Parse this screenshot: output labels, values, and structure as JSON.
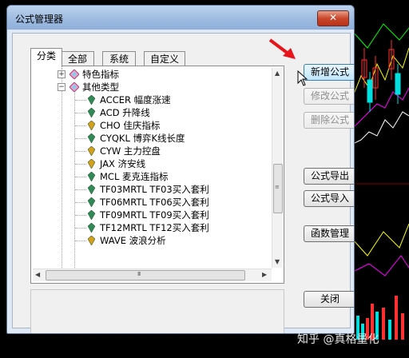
{
  "dialog": {
    "title": "公式管理器",
    "close_glyph": "✕",
    "tabs": [
      {
        "label": "分类",
        "active": true
      },
      {
        "label": "全部",
        "active": false
      },
      {
        "label": "系统",
        "active": false
      },
      {
        "label": "自定义",
        "active": false
      }
    ],
    "tree": {
      "categories": [
        {
          "label": "特色指标",
          "expanded": false
        },
        {
          "label": "其他类型",
          "expanded": true
        }
      ],
      "formulas": [
        {
          "label": "ACCER 幅度涨速",
          "color": "#2e8b57"
        },
        {
          "label": "ACD 升降线",
          "color": "#2e8b57"
        },
        {
          "label": "CHO 佳庆指标",
          "color": "#d4a017"
        },
        {
          "label": "CYQKL 博弈K线长度",
          "color": "#2e8b57"
        },
        {
          "label": "CYW 主力控盘",
          "color": "#d4a017"
        },
        {
          "label": "JAX 济安线",
          "color": "#d4a017"
        },
        {
          "label": "MCL 麦克连指标",
          "color": "#2e8b57"
        },
        {
          "label": "TF03MRTL TF03买入套利",
          "color": "#2e8b57"
        },
        {
          "label": "TF06MRTL TF06买入套利",
          "color": "#2e8b57"
        },
        {
          "label": "TF09MRTL TF09买入套利",
          "color": "#2e8b57"
        },
        {
          "label": "TF12MRTL TF12买入套利",
          "color": "#2e8b57"
        },
        {
          "label": "WAVE 波浪分析",
          "color": "#d4a017"
        }
      ],
      "scroll_grip": "III"
    },
    "buttons": {
      "new_formula": "新增公式",
      "edit_formula": "修改公式",
      "delete_formula": "删除公式",
      "export_formula": "公式导出",
      "import_formula": "公式导入",
      "function_manage": "函数管理",
      "close": "关闭"
    }
  },
  "watermark": "知乎 @真格量化",
  "colors": {
    "arrow": "#e8141b",
    "accent": "#3c7fb1"
  }
}
